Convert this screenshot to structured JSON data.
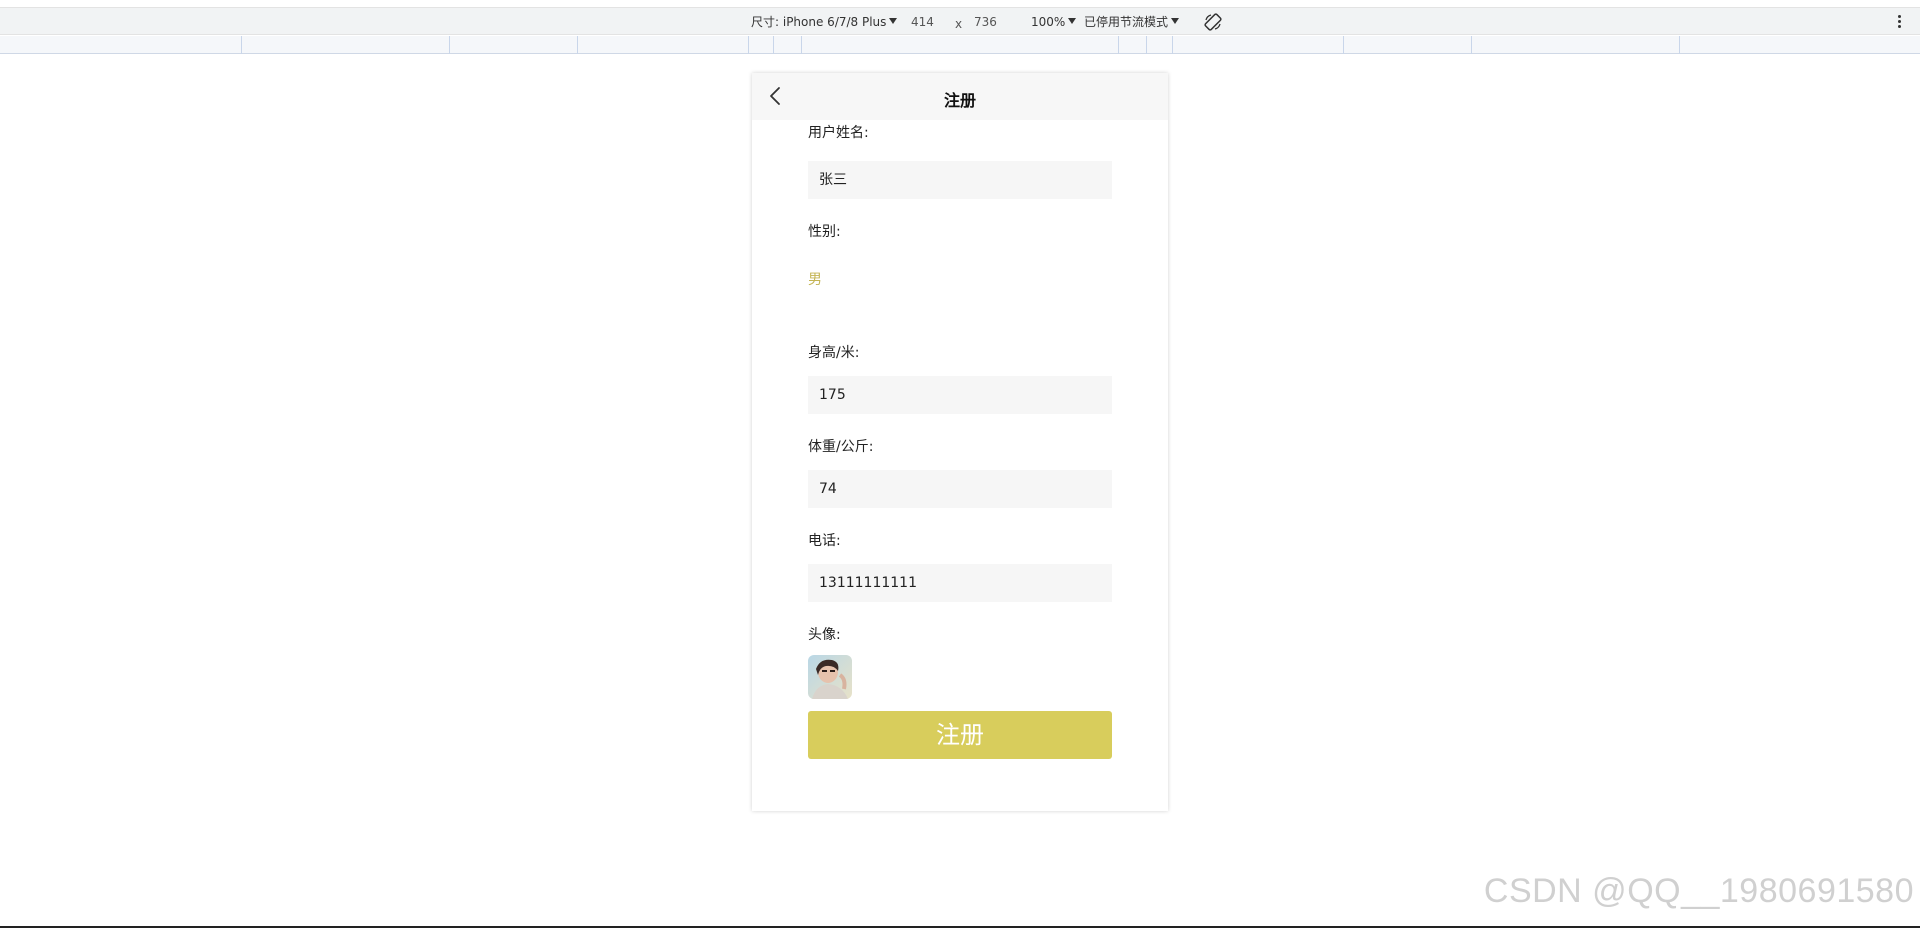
{
  "devtools": {
    "size_label": "尺寸: iPhone 6/7/8 Plus",
    "width": "414",
    "times": "x",
    "height": "736",
    "zoom": "100%",
    "throttle": "已停用节流模式"
  },
  "page": {
    "title": "注册",
    "fields": {
      "name": {
        "label": "用户姓名:",
        "value": "张三"
      },
      "gender": {
        "label": "性别:",
        "value": "男"
      },
      "height": {
        "label": "身高/米:",
        "value": "175"
      },
      "weight": {
        "label": "体重/公斤:",
        "value": "74"
      },
      "phone": {
        "label": "电话:",
        "value": "13111111111"
      },
      "avatar": {
        "label": "头像:"
      }
    },
    "submit_label": "注册"
  },
  "watermark": "CSDN @QQ__1980691580",
  "colors": {
    "accent": "#d8cd5c",
    "gender_text": "#c4b454",
    "field_bg": "#f6f6f6"
  }
}
